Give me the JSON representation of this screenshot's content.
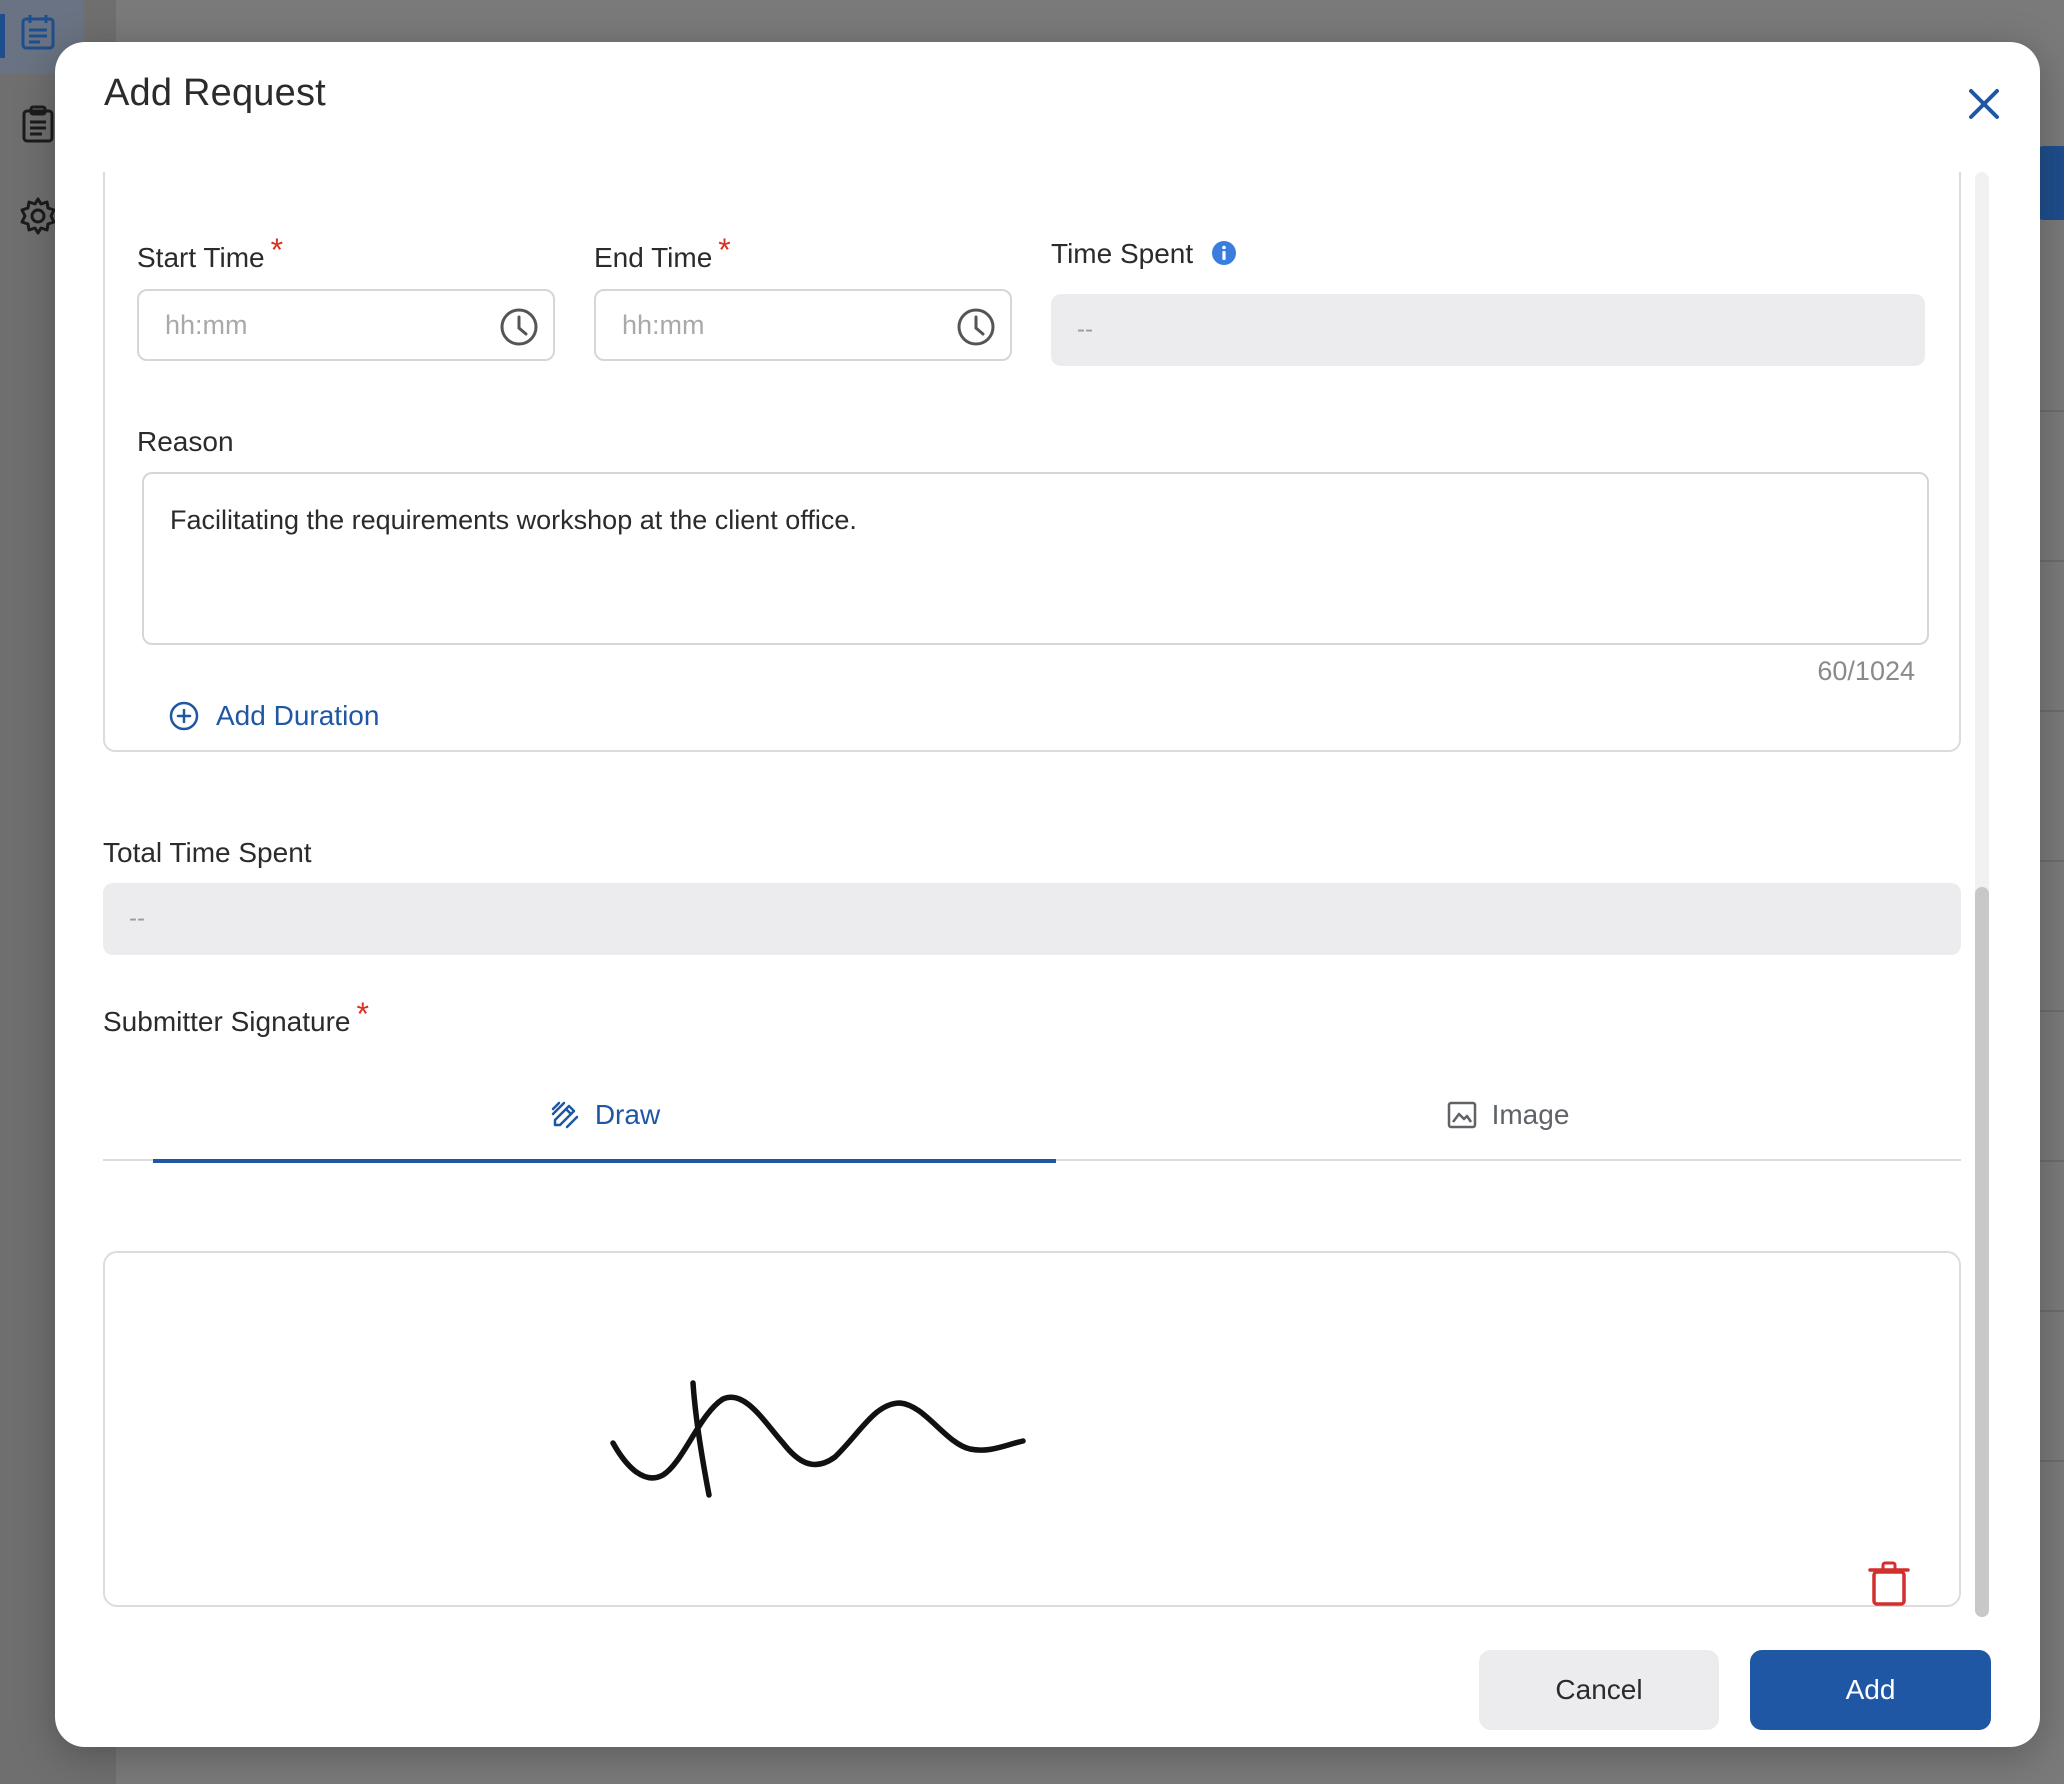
{
  "modal": {
    "title": "Add Request",
    "close_icon": "close-icon"
  },
  "form": {
    "start_time": {
      "label": "Start Time",
      "required_mark": "*",
      "placeholder": "hh:mm",
      "icon": "clock-icon"
    },
    "end_time": {
      "label": "End Time",
      "required_mark": "*",
      "placeholder": "hh:mm",
      "icon": "clock-icon"
    },
    "time_spent": {
      "label": "Time Spent",
      "value": "--",
      "icon": "info-icon"
    },
    "reason": {
      "label": "Reason",
      "value": "Facilitating the requirements workshop at the client office.",
      "counter": "60/1024"
    },
    "add_duration": {
      "label": "Add Duration",
      "icon": "plus-circle-icon"
    },
    "total_time_spent": {
      "label": "Total Time Spent",
      "value": "--"
    },
    "signature": {
      "label": "Submitter Signature",
      "required_mark": "*",
      "tabs": [
        {
          "label": "Draw",
          "icon": "draw-icon",
          "active": true
        },
        {
          "label": "Image",
          "icon": "image-icon",
          "active": false
        }
      ],
      "delete_icon": "trash-icon"
    }
  },
  "actions": {
    "cancel_label": "Cancel",
    "add_label": "Add"
  },
  "colors": {
    "primary": "#1f57a4",
    "required": "#d93025",
    "delete": "#d32f2f"
  }
}
